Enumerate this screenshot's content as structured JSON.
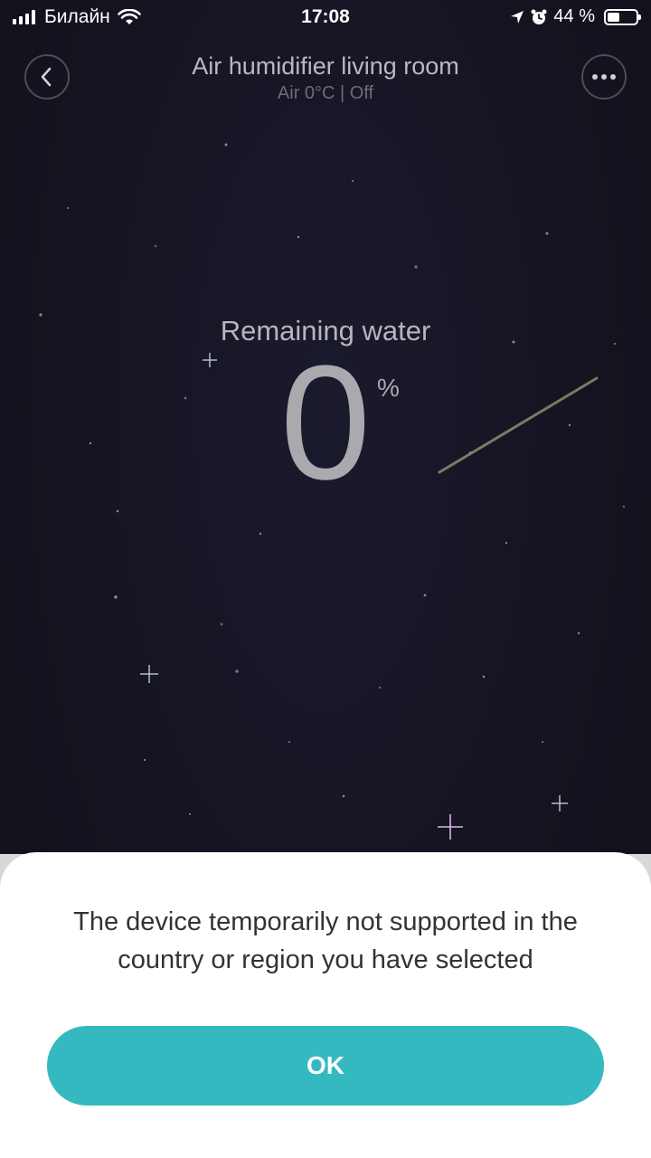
{
  "status_bar": {
    "carrier": "Билайн",
    "time": "17:08",
    "battery_percent": "44 %",
    "battery_level": 0.44,
    "icons": [
      "signal-icon",
      "wifi-icon",
      "location-arrow-icon",
      "alarm-icon",
      "battery-icon"
    ]
  },
  "header": {
    "title": "Air humidifier living room",
    "subtitle": "Air 0°C | Off",
    "back_icon": "chevron-left-icon",
    "more_icon": "more-dots-icon"
  },
  "reading": {
    "label": "Remaining water",
    "value": "0",
    "unit": "%"
  },
  "dialog": {
    "message": "The device temporarily not supported in the country or region you have selected",
    "ok_label": "OK",
    "accent_color": "#34b9c1"
  },
  "colors": {
    "background": "#14131f",
    "sheet": "#ffffff",
    "text_muted": "#b8b8c2"
  }
}
